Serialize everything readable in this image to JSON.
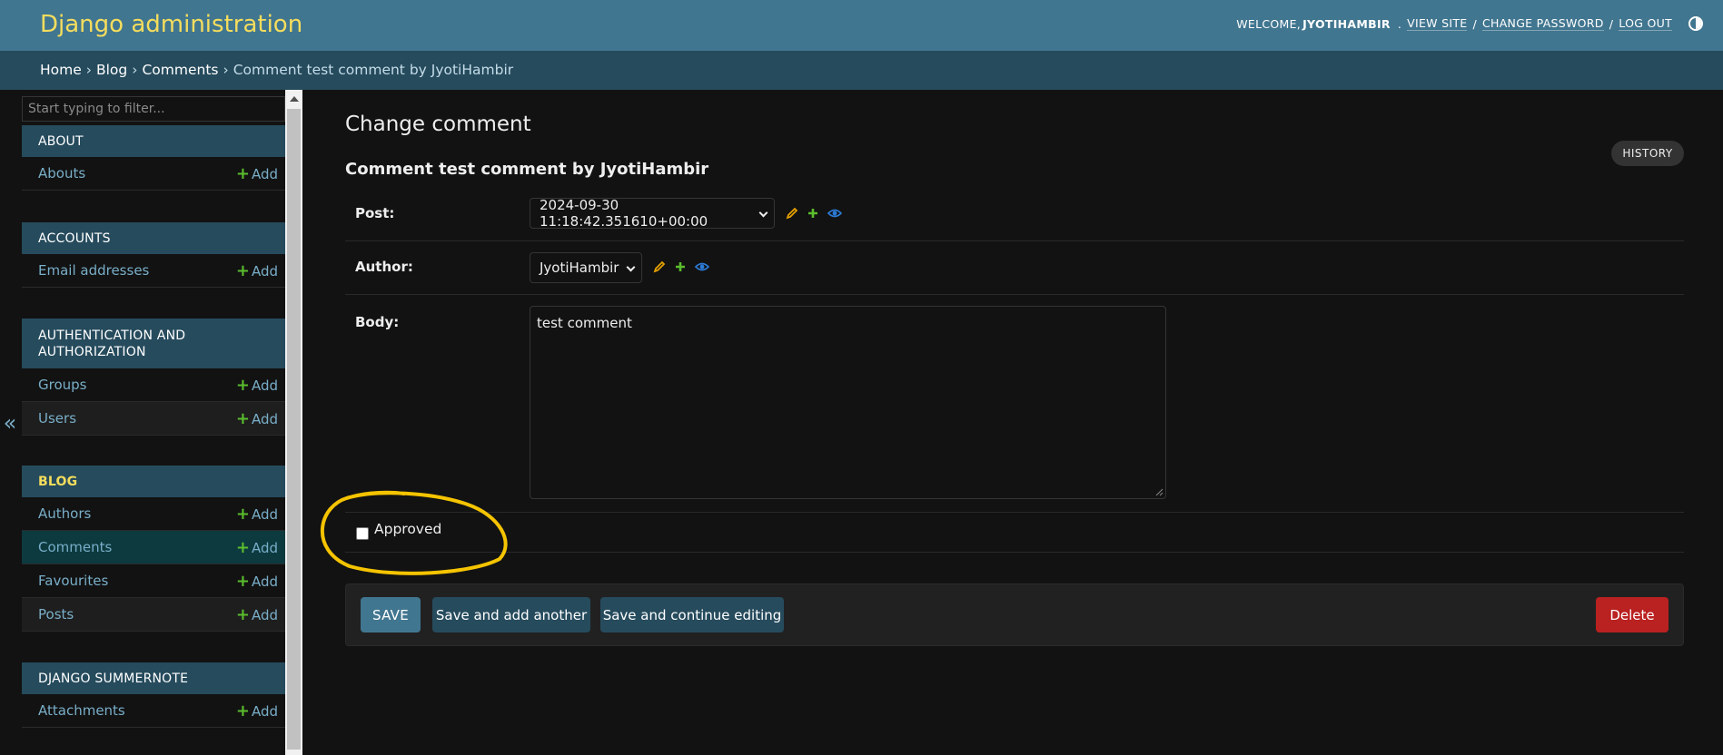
{
  "header": {
    "branding": "Django administration",
    "welcome": "WELCOME,",
    "username": "JYOTIHAMBIR",
    "view_site": "VIEW SITE",
    "change_password": "CHANGE PASSWORD",
    "log_out": "LOG OUT",
    "sep": "/",
    "colors": {
      "bg": "#417690",
      "brand": "#f5dd5d"
    }
  },
  "breadcrumbs": {
    "home": "Home",
    "blog": "Blog",
    "comments": "Comments",
    "current": "Comment test comment by JyotiHambir",
    "sep": "›"
  },
  "sidebar": {
    "collapse_icon": "«",
    "filter_placeholder": "Start typing to filter...",
    "add_label": "Add",
    "add_plus": "+",
    "modules": [
      {
        "caption": "ABOUT",
        "items": [
          {
            "name": "Abouts"
          }
        ]
      },
      {
        "caption": "ACCOUNTS",
        "items": [
          {
            "name": "Email addresses"
          }
        ]
      },
      {
        "caption": "AUTHENTICATION AND AUTHORIZATION",
        "items": [
          {
            "name": "Groups"
          },
          {
            "name": "Users"
          }
        ]
      },
      {
        "caption": "BLOG",
        "active": true,
        "items": [
          {
            "name": "Authors"
          },
          {
            "name": "Comments",
            "current": true
          },
          {
            "name": "Favourites"
          },
          {
            "name": "Posts"
          }
        ]
      },
      {
        "caption": "DJANGO SUMMERNOTE",
        "items": [
          {
            "name": "Attachments"
          }
        ]
      }
    ]
  },
  "content": {
    "title": "Change comment",
    "history": "HISTORY",
    "object_title": "Comment test comment by JyotiHambir",
    "fields": {
      "post": {
        "label": "Post:",
        "value": "2024-09-30 11:18:42.351610+00:00"
      },
      "author": {
        "label": "Author:",
        "value": "JyotiHambir"
      },
      "body": {
        "label": "Body:",
        "value": "test comment"
      },
      "approved": {
        "label": "Approved",
        "checked": false
      }
    },
    "buttons": {
      "save": "SAVE",
      "save_add_another": "Save and add another",
      "save_continue": "Save and continue editing",
      "delete": "Delete"
    }
  },
  "colors": {
    "background": "#121212",
    "link": "#79aec8",
    "add_plus": "#5bbd2d",
    "edit_icon": "#e5a000",
    "view_icon": "#2c7bd6",
    "delete": "#ba2121",
    "annotation": "#f5c400"
  }
}
